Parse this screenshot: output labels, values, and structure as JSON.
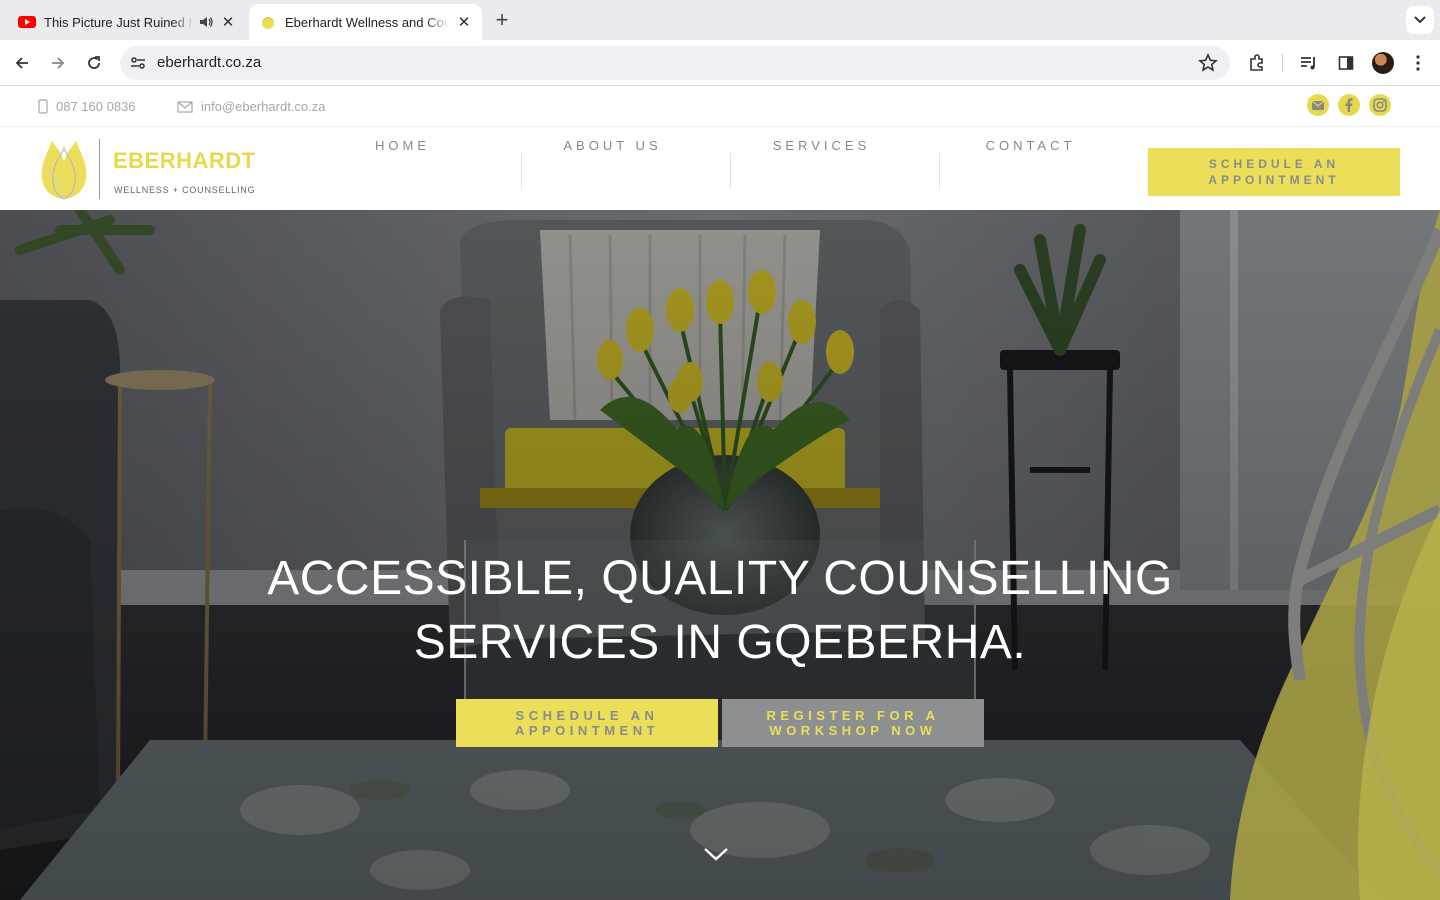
{
  "browser": {
    "tabs": [
      {
        "title": "This Picture Just Ruined H",
        "favicon": "youtube-icon",
        "audio": true,
        "active": false
      },
      {
        "title": "Eberhardt Wellness and Coun",
        "favicon": "eberhardt-tulip-icon",
        "active": true
      }
    ],
    "url": "eberhardt.co.za"
  },
  "topbar": {
    "phone": "087 160 0836",
    "email": "info@eberhardt.co.za",
    "social": [
      "email-icon",
      "facebook-icon",
      "instagram-icon"
    ]
  },
  "header": {
    "logo": {
      "brand": "EBERHARDT",
      "tagline": "WELLNESS + COUNSELLING"
    },
    "nav": [
      "HOME",
      "ABOUT US",
      "SERVICES",
      "CONTACT"
    ],
    "cta": "SCHEDULE AN APPOINTMENT"
  },
  "hero": {
    "headline_line1": "ACCESSIBLE, QUALITY COUNSELLING",
    "headline_line2": "SERVICES IN GQEBERHA.",
    "primary_button": "SCHEDULE AN APPOINTMENT",
    "secondary_button": "REGISTER FOR A WORKSHOP NOW"
  },
  "colors": {
    "brand_yellow": "#ebdf59",
    "button_grey": "#8e8f91",
    "text_grey": "#888888"
  }
}
